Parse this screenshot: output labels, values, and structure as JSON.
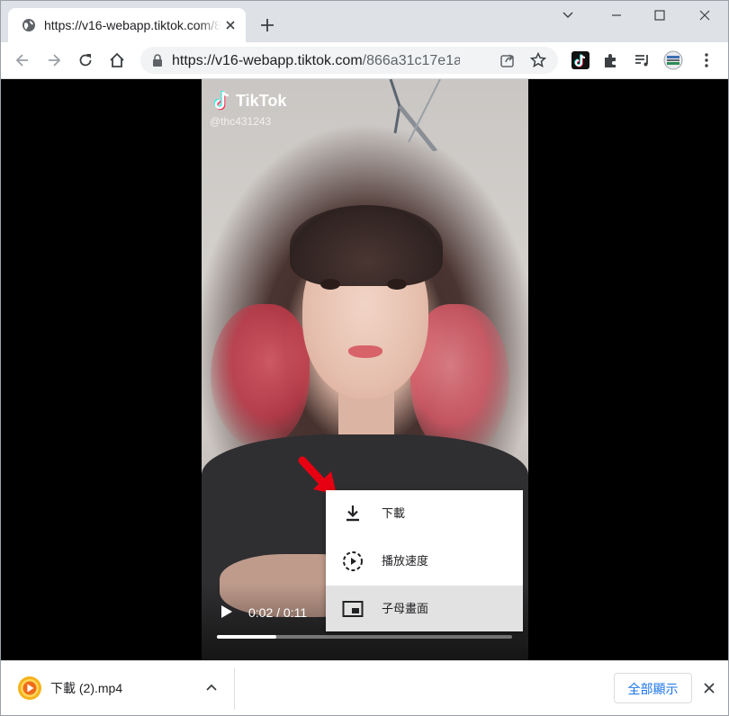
{
  "tab": {
    "title": "https://v16-webapp.tiktok.com/866a31c17e1a...",
    "favicon": "globe-icon"
  },
  "toolbar": {
    "url_host": "https://v16-webapp.tiktok.com",
    "url_path": "/866a31c17e1a..."
  },
  "video": {
    "brand": "TikTok",
    "username": "@thc431243",
    "current_time": "0:02",
    "duration": "0:11",
    "time_display": "0:02 / 0:11",
    "progress": 0.2
  },
  "menu": {
    "items": [
      {
        "label": "下載",
        "icon": "download-icon"
      },
      {
        "label": "播放速度",
        "icon": "playback-speed-icon"
      },
      {
        "label": "子母畫面",
        "icon": "picture-in-picture-icon",
        "highlighted": true
      }
    ]
  },
  "downloads": {
    "file_name": "下載 (2).mp4",
    "show_all_label": "全部顯示"
  },
  "colors": {
    "tab_strip": "#dee1e6",
    "omnibox": "#f1f3f4",
    "accent_blue": "#1a73e8",
    "arrow_red": "#e60012",
    "menu_highlight": "#e2e2e2"
  }
}
